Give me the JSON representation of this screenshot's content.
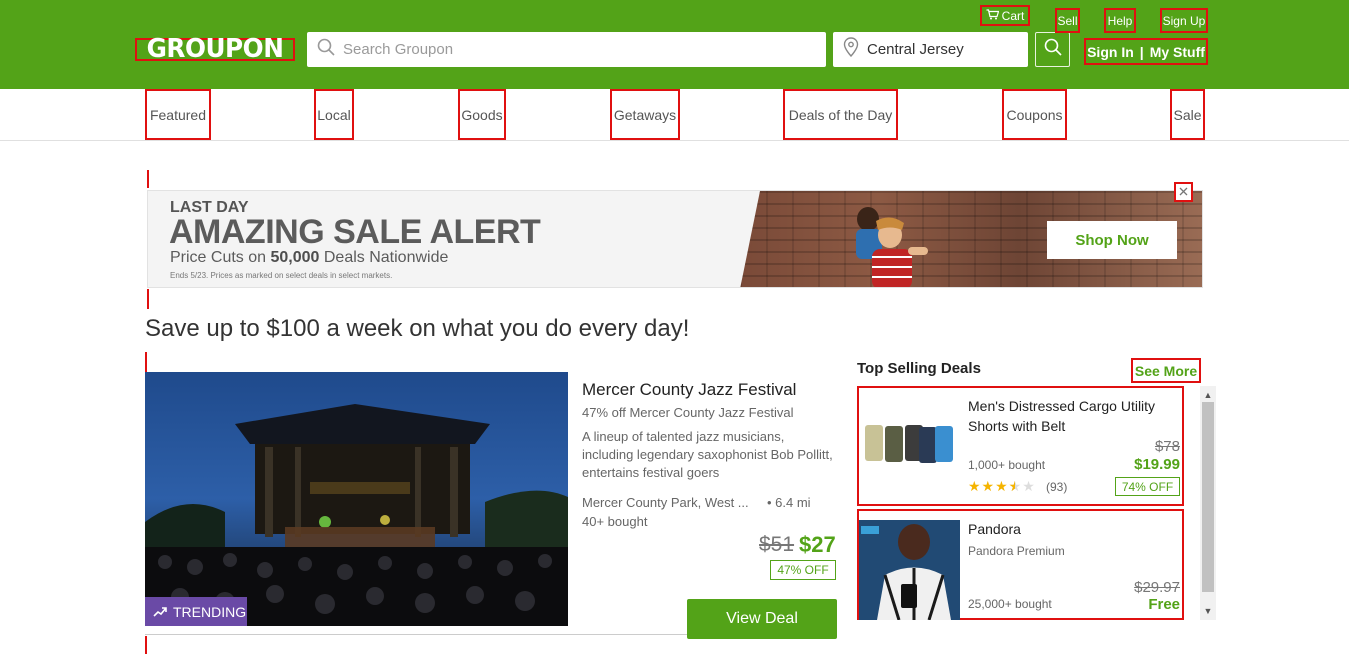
{
  "header": {
    "logo": "GROUPON",
    "search_placeholder": "Search Groupon",
    "location": "Central Jersey",
    "cart_label": "Cart",
    "sell_label": "Sell",
    "help_label": "Help",
    "signup_label": "Sign Up",
    "signin_label": "Sign In",
    "separator": "|",
    "mystuff_label": "My Stuff",
    "colors": {
      "brand": "#53a318"
    }
  },
  "nav": {
    "items": [
      {
        "label": "Featured"
      },
      {
        "label": "Local"
      },
      {
        "label": "Goods"
      },
      {
        "label": "Getaways"
      },
      {
        "label": "Deals of the Day"
      },
      {
        "label": "Coupons"
      },
      {
        "label": "Sale"
      }
    ]
  },
  "banner": {
    "kicker": "LAST DAY",
    "title": "AMAZING SALE ALERT",
    "subtitle_pre": "Price Cuts on ",
    "subtitle_num": "50,000",
    "subtitle_post": " Deals Nationwide",
    "fine_print": "Ends 5/23. Prices as marked on select deals in select markets.",
    "cta": "Shop Now",
    "close_icon": "close-icon"
  },
  "headline": "Save up to $100 a week on what you do every day!",
  "featured_deal": {
    "badge": "TRENDING",
    "title": "Mercer County Jazz Festival",
    "subtitle": "47% off Mercer County Jazz Festival",
    "description": "A lineup of talented jazz musicians, including legendary saxophonist Bob Pollitt, entertains festival goers",
    "location": "Mercer County Park, West ...",
    "distance": "• 6.4 mi",
    "bought": "40+ bought",
    "original_price": "$51",
    "price": "$27",
    "discount": "47% OFF",
    "cta": "View Deal"
  },
  "sidebar": {
    "title": "Top Selling Deals",
    "see_more": "See More",
    "cards": [
      {
        "title": "Men's Distressed Cargo Utility Shorts with Belt",
        "bought": "1,000+ bought",
        "original_price": "$78",
        "price": "$19.99",
        "discount": "74% OFF",
        "rating_stars": 3.5,
        "rating_count": "(93)"
      },
      {
        "title": "Pandora",
        "subtitle": "Pandora Premium",
        "bought": "25,000+ bought",
        "original_price": "$29.97",
        "price": "Free"
      }
    ]
  }
}
